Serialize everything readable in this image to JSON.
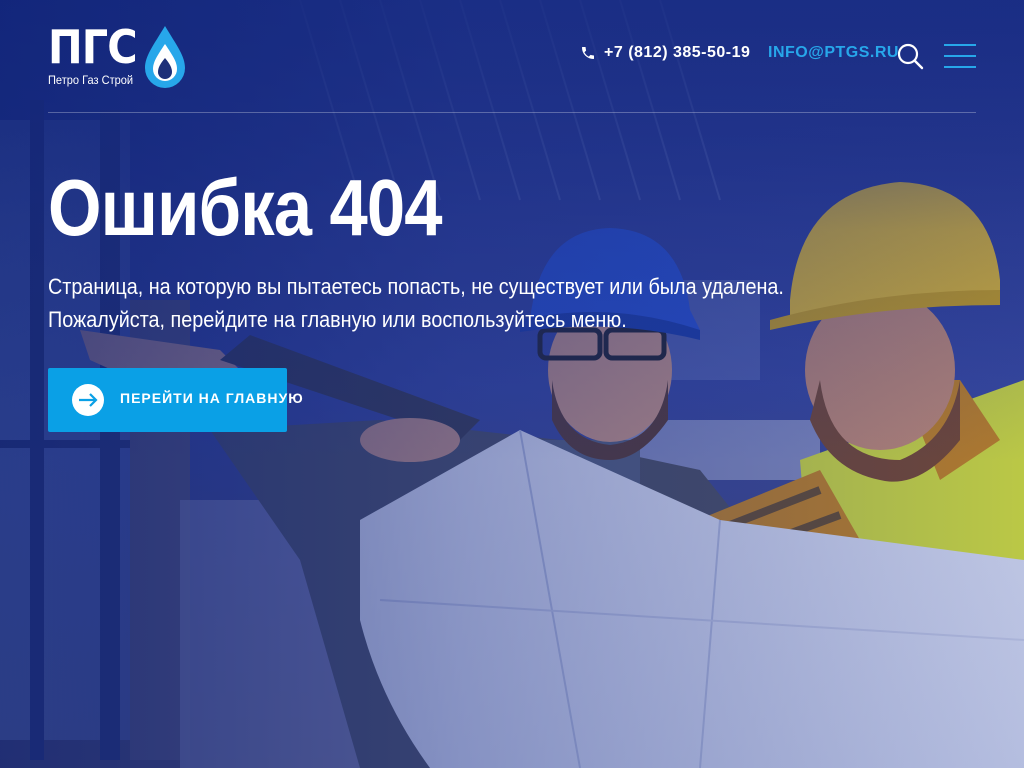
{
  "header": {
    "logo": {
      "word": "ПГС",
      "tagline": "Петро Газ Строй",
      "icon": "gas-drop-icon"
    },
    "phone": {
      "icon": "phone-icon",
      "text": "+7 (812) 385-50-19"
    },
    "email": "INFO@PTGS.RU",
    "search_icon": "search-icon",
    "menu_icon": "hamburger-menu-icon"
  },
  "error": {
    "title": "Ошибка 404",
    "description": "Страница, на которую вы пытаетесь попасть, не существует или была удалена. Пожалуйста, перейдите на главную или воспользуйтесь меню.",
    "button": {
      "label": "ПЕРЕЙТИ НА ГЛАВНУЮ",
      "icon": "arrow-right-icon"
    }
  },
  "colors": {
    "background": "#1d2f78",
    "accent": "#0aa0e6",
    "link": "#27a7ea",
    "text": "#ffffff"
  }
}
